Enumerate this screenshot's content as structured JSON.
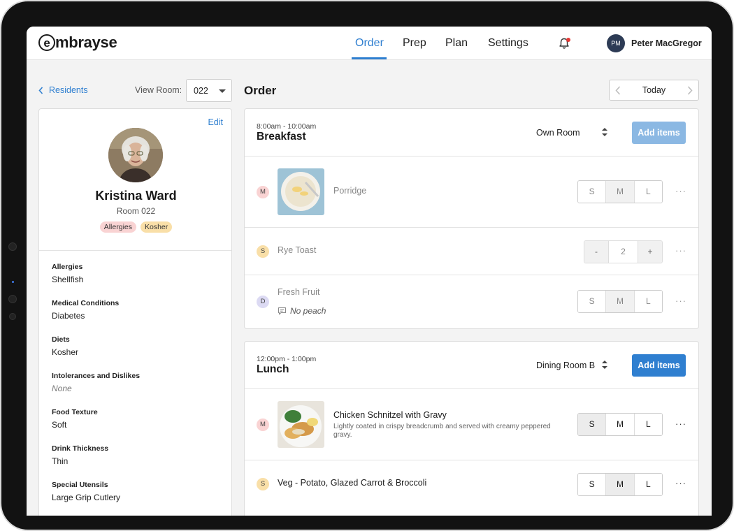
{
  "brand": {
    "logo_letter": "e",
    "logo_rest": "mbrayse"
  },
  "nav": {
    "items": [
      {
        "label": "Order",
        "active": true
      },
      {
        "label": "Prep",
        "active": false
      },
      {
        "label": "Plan",
        "active": false
      },
      {
        "label": "Settings",
        "active": false
      }
    ],
    "notification_icon": "bell-icon",
    "user": {
      "initials": "PM",
      "name": "Peter MacGregor"
    }
  },
  "sidebar": {
    "back_label": "Residents",
    "view_room_label": "View Room:",
    "room_value": "022"
  },
  "resident": {
    "edit_label": "Edit",
    "name": "Kristina Ward",
    "room": "Room 022",
    "tags": [
      "Allergies",
      "Kosher"
    ],
    "details": [
      {
        "label": "Allergies",
        "value": "Shellfish"
      },
      {
        "label": "Medical Conditions",
        "value": "Diabetes"
      },
      {
        "label": "Diets",
        "value": "Kosher"
      },
      {
        "label": "Intolerances and Dislikes",
        "value": "None"
      },
      {
        "label": "Food Texture",
        "value": "Soft"
      },
      {
        "label": "Drink Thickness",
        "value": "Thin"
      },
      {
        "label": "Special Utensils",
        "value": "Large Grip Cutlery"
      }
    ]
  },
  "order": {
    "title": "Order",
    "date_label": "Today",
    "meals": [
      {
        "time": "8:00am - 10:00am",
        "name": "Breakfast",
        "location": "Own Room",
        "add_label": "Add items",
        "items": [
          {
            "badge": "M",
            "name": "Porridge",
            "sizes": [
              "S",
              "M",
              "L"
            ],
            "selected": "M"
          },
          {
            "badge": "S",
            "name": "Rye Toast",
            "stepper": {
              "minus": "-",
              "value": "2",
              "plus": "+"
            }
          },
          {
            "badge": "D",
            "name": "Fresh Fruit",
            "note": "No peach",
            "sizes": [
              "S",
              "M",
              "L"
            ],
            "selected": "M"
          }
        ]
      },
      {
        "time": "12:00pm - 1:00pm",
        "name": "Lunch",
        "location": "Dining Room B",
        "add_label": "Add items",
        "items": [
          {
            "badge": "M",
            "name": "Chicken Schnitzel with Gravy",
            "description": "Lightly coated in crispy breadcrumb and served with creamy peppered gravy.",
            "sizes": [
              "S",
              "M",
              "L"
            ],
            "selected": "S"
          },
          {
            "badge": "S",
            "name": "Veg - Potato, Glazed Carrot & Broccoli",
            "sizes": [
              "S",
              "M",
              "L"
            ],
            "selected": "M"
          }
        ]
      }
    ],
    "more_label": "···"
  },
  "colors": {
    "accent": "#2f7fd0",
    "accent_disabled": "#8bb8e3",
    "alert": "#e53935"
  }
}
